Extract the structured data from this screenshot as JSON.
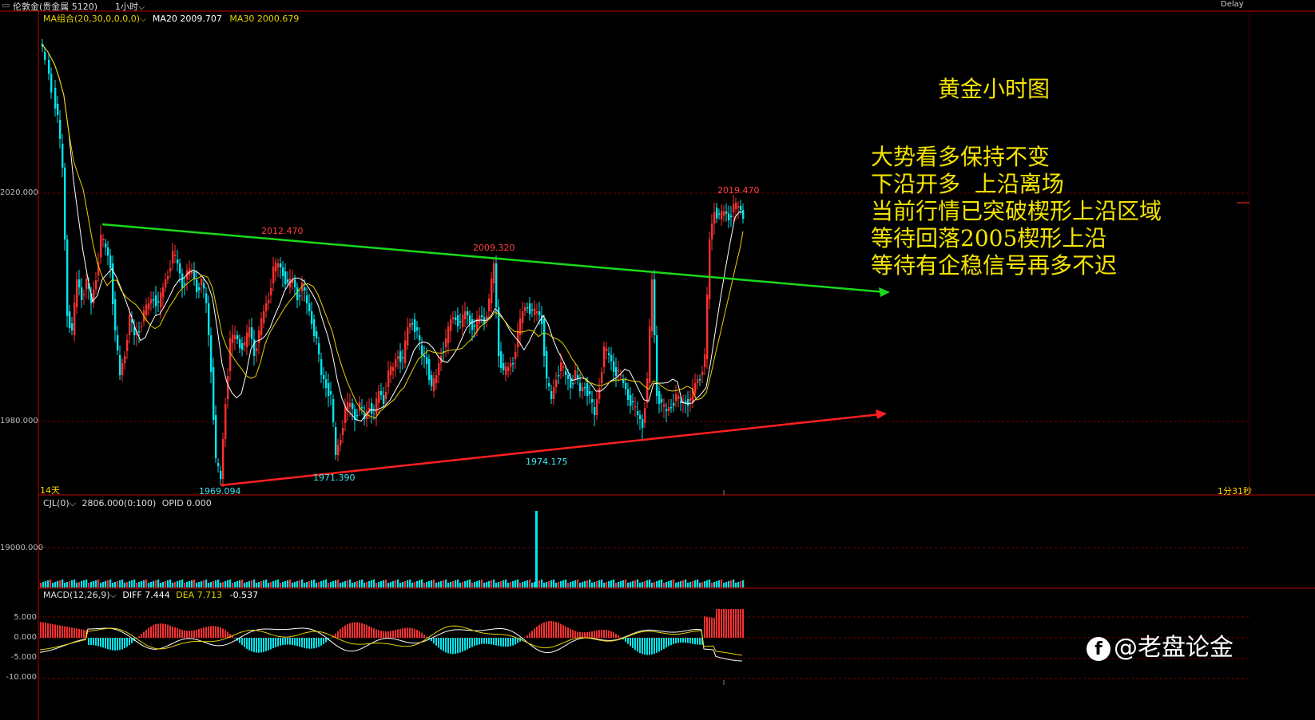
{
  "window": {
    "title": "伦敦金(贵金属 5120)",
    "period": "1小时",
    "status": "Delay"
  },
  "main_panel": {
    "indicator_name": "MA组合(20,30,0,0,0,0)",
    "ma20_label": "MA20 2009.707",
    "ma30_label": "MA30 2000.679",
    "y_ticks": [
      "2020.000",
      "1980.000"
    ],
    "left_footer": "14天",
    "right_footer": "1分31秒",
    "price_labels": {
      "high1": "2012.470",
      "high2": "2009.320",
      "high3": "2019.470",
      "low1": "1969.094",
      "low2": "1971.390",
      "low3": "1974.175"
    },
    "annotation_title": "黄金小时图",
    "annotation_lines": [
      "大势看多保持不变",
      "下沿开多  上沿离场",
      "当前行情已突破楔形上沿区域",
      "等待回落2005楔形上沿",
      "等待有企稳信号再多不迟"
    ],
    "colors": {
      "upper_line": "#19d919",
      "lower_line": "#ff2020",
      "candle_up": "#ff3030",
      "candle_down": "#00e5ee",
      "ma20": "#ffffff",
      "ma30": "#e6d200",
      "annotation": "#f5e400"
    }
  },
  "volume_panel": {
    "indicator_name": "CJL(0)",
    "value_label": "2806.000(0:100)",
    "opid_label": "OPID 0.000",
    "y_tick": "19000.000"
  },
  "macd_panel": {
    "indicator_name": "MACD(12,26,9)",
    "diff_label": "DIFF 7.444",
    "dea_label": "DEA 7.713",
    "macd_value": "-0.537",
    "y_ticks": [
      "5.000",
      "0.000",
      "-5.000",
      "-10.000"
    ]
  },
  "watermark": {
    "icon": "facebook-icon",
    "text": "@老盘论金"
  }
}
